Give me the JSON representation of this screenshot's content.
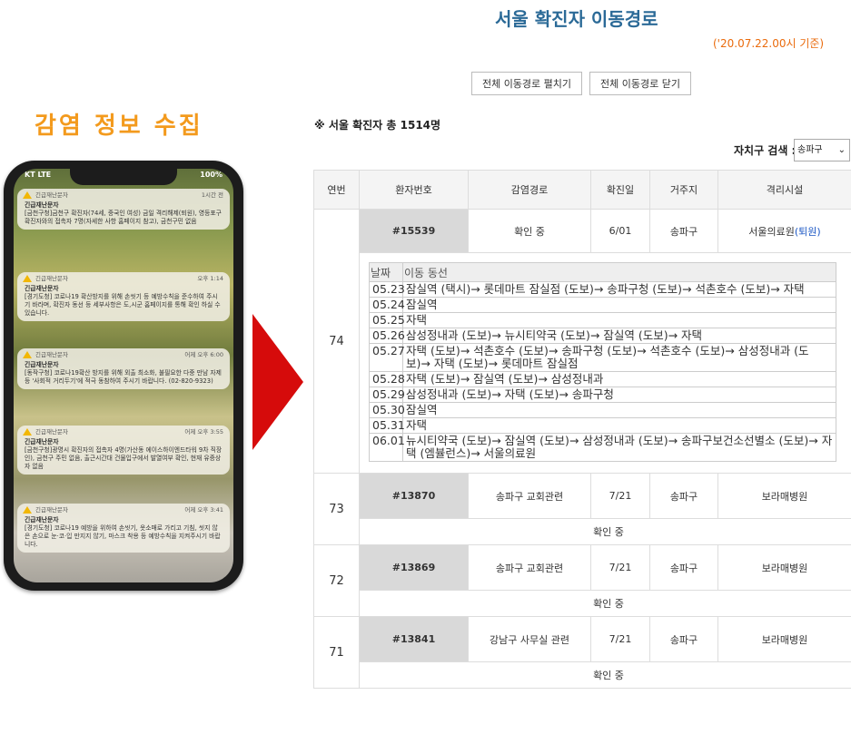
{
  "left": {
    "title": "감염 정보 수집",
    "phone": {
      "carrier": "KT LTE",
      "battery": "100%",
      "notifications": [
        {
          "app": "긴급재난문자",
          "time": "1시간 전",
          "title": "긴급재난문자",
          "body": "[금천구청]금천구 확진자(74세, 중국인 여성) 금일 격리해제(퇴원), 영등포구 확진자와의 접촉자 7명(자세한 사항 홈페이지 참고), 금천구민 없음"
        },
        {
          "app": "긴급재난문자",
          "time": "오후 1:14",
          "title": "긴급재난문자",
          "body": "[경기도청] 코로나19 확산방지를 위해 손씻기 등 예방수칙을 준수하여 주시기 바라며, 확진자 동선 등 세부사항은 도,시군 홈페이지를 통해 확인 하실 수 있습니다."
        },
        {
          "app": "긴급재난문자",
          "time": "어제 오후 6:00",
          "title": "긴급재난문자",
          "body": "[동작구청] 코로나19확산 방지를 위해 외출 최소화, 불필요한 다중 만남 자제 등 '사회적 거리두기'에 적극 동참하여 주시기 바랍니다. (02-820-9323)"
        },
        {
          "app": "긴급재난문자",
          "time": "어제 오후 3:55",
          "title": "긴급재난문자",
          "body": "[금천구청]광명시 확진자의 접촉자 4명(가산동 에이스하이엔드타워 9차 직장인), 금천구 주민 없음, 출근시간대 건물입구에서 발열여부 확인, 현재 유증상자 없음"
        },
        {
          "app": "긴급재난문자",
          "time": "어제 오후 3:41",
          "title": "긴급재난문자",
          "body": "[경기도청] 코로나19 예방을 위하여 손씻기, 옷소매로 가리고 기침, 씻지 않은 손으로 눈·코·입 만지지 않기, 마스크 착용 등 예방수칙을 지켜주시기 바랍니다."
        }
      ]
    }
  },
  "right": {
    "title": "서울 확진자 이동경로",
    "base_date": "('20.07.22.00시 기준)",
    "expand_all_label": "전체 이동경로 펼치기",
    "collapse_all_label": "전체 이동경로 닫기",
    "total": "※ 서울 확진자 총 1514명",
    "district_search_label": "자치구 검색 :",
    "district_selected": "송파구",
    "table": {
      "headers": [
        "연번",
        "환자번호",
        "감염경로",
        "확진일",
        "거주지",
        "격리시설"
      ],
      "rows": [
        {
          "no": "74",
          "id": "#15539",
          "route": "확인 중",
          "date": "6/01",
          "residence": "송파구",
          "facility": "서울의료원",
          "facility_note": "(퇴원)",
          "movement": {
            "headers": [
              "날짜",
              "이동 동선"
            ],
            "entries": [
              {
                "date": "05.23",
                "path": "잠실역 (택시)→ 롯데마트 잠실점 (도보)→ 송파구청 (도보)→ 석촌호수 (도보)→ 자택"
              },
              {
                "date": "05.24",
                "path": "잠실역"
              },
              {
                "date": "05.25",
                "path": "자택"
              },
              {
                "date": "05.26",
                "path": "삼성정내과 (도보)→ 뉴시티약국 (도보)→ 잠실역 (도보)→ 자택"
              },
              {
                "date": "05.27",
                "path": "자택 (도보)→ 석촌호수 (도보)→ 송파구청 (도보)→ 석촌호수 (도보)→ 삼성정내과 (도보)→ 자택 (도보)→ 롯데마트 잠실점"
              },
              {
                "date": "05.28",
                "path": "자택 (도보)→ 잠실역 (도보)→ 삼성정내과"
              },
              {
                "date": "05.29",
                "path": "삼성정내과 (도보)→ 자택 (도보)→ 송파구청"
              },
              {
                "date": "05.30",
                "path": "잠실역"
              },
              {
                "date": "05.31",
                "path": "자택"
              },
              {
                "date": "06.01",
                "path": "뉴시티약국 (도보)→ 잠실역 (도보)→ 삼성정내과 (도보)→ 송파구보건소선별소 (도보)→ 자택 (엠뷸런스)→ 서울의료원"
              }
            ]
          }
        },
        {
          "no": "73",
          "id": "#13870",
          "route": "송파구 교회관련",
          "date": "7/21",
          "residence": "송파구",
          "facility": "보라매병원",
          "status": "확인 중"
        },
        {
          "no": "72",
          "id": "#13869",
          "route": "송파구 교회관련",
          "date": "7/21",
          "residence": "송파구",
          "facility": "보라매병원",
          "status": "확인 중"
        },
        {
          "no": "71",
          "id": "#13841",
          "route": "강남구 사무실 관련",
          "date": "7/21",
          "residence": "송파구",
          "facility": "보라매병원",
          "status": "확인 중"
        }
      ]
    }
  }
}
